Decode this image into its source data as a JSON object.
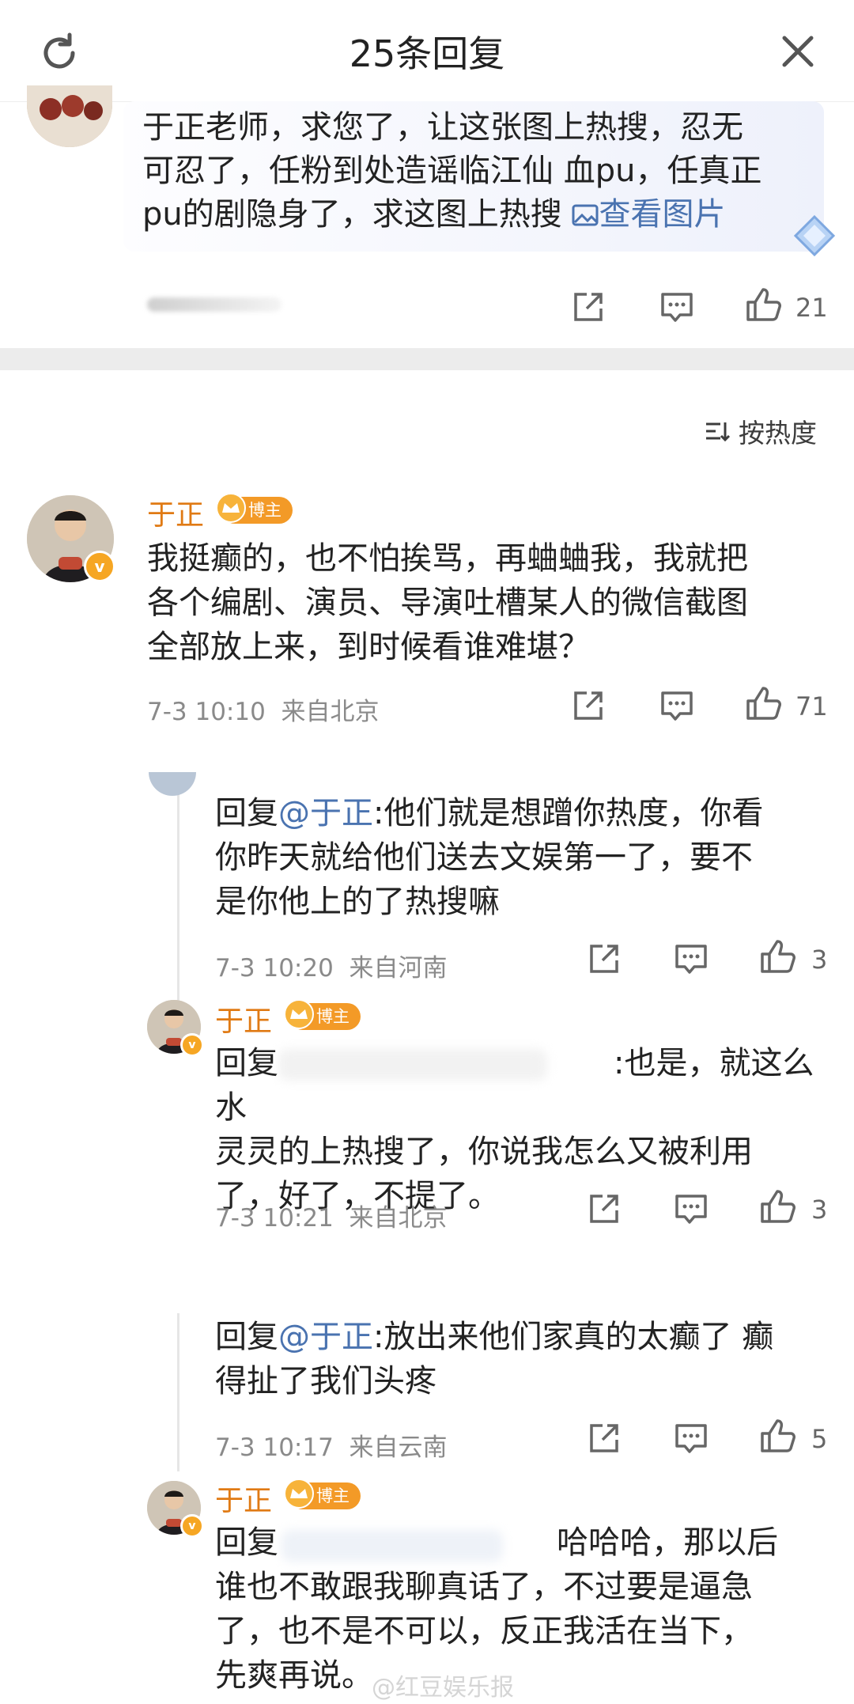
{
  "header": {
    "title": "25条回复"
  },
  "top_comment": {
    "text_plain": "于正老师，求您了，让这张图上热搜，忍无可忍了，任粉到处造谣临江仙 血pu，任真正pu的剧隐身了，求这图上热搜",
    "line1": "于正老师，求您了，让这张图上热搜，忍无",
    "line2": "可忍了，任粉到处造谣临江仙 血pu，任真正",
    "line3": "pu的剧隐身了，求这图上热搜",
    "image_link": "查看图片",
    "likes": "21"
  },
  "sort_label": "按热度",
  "main_comment": {
    "name": "于正",
    "badge": "博主",
    "line1": "我挺癫的，也不怕挨骂，再蛐蛐我，我就把",
    "line2": "各个编剧、演员、导演吐槽某人的微信截图",
    "line3": "全部放上来，到时候看谁难堪？",
    "time": "7-3 10:10",
    "location": "来自北京",
    "likes": "71"
  },
  "replies": [
    {
      "prefix": "回复",
      "at": "@于正",
      "line1": ":他们就是想蹭你热度，你看",
      "line2": "你昨天就给他们送去文娱第一了，要不",
      "line3": "是你他上的了热搜嘛",
      "time": "7-3 10:20",
      "location": "来自河南",
      "likes": "3"
    },
    {
      "name": "于正",
      "badge": "博主",
      "prefix": "回复",
      "line1_end": ":也是，就这么水",
      "line2": "灵灵的上热搜了，你说我怎么又被利用",
      "line3": "了，好了，不提了。",
      "time": "7-3 10:21",
      "location": "来自北京",
      "likes": "3"
    },
    {
      "prefix": "回复",
      "at": "@于正",
      "line1": ":放出来他们家真的太癫了 癫",
      "line2": "得扯了我们头疼",
      "time": "7-3 10:17",
      "location": "来自云南",
      "likes": "5"
    },
    {
      "name": "于正",
      "badge": "博主",
      "prefix": "回复",
      "line1_end": "哈哈哈，那以后",
      "line2": "谁也不敢跟我聊真话了，不过要是逼急",
      "line3": "了，也不是不可以，反正我活在当下，",
      "line4": "先爽再说。"
    }
  ],
  "watermark": "@红豆娱乐报",
  "colors": {
    "name_orange": "#e07a14",
    "link_blue": "#4a73b0",
    "badge_orange": "#f39a27"
  }
}
